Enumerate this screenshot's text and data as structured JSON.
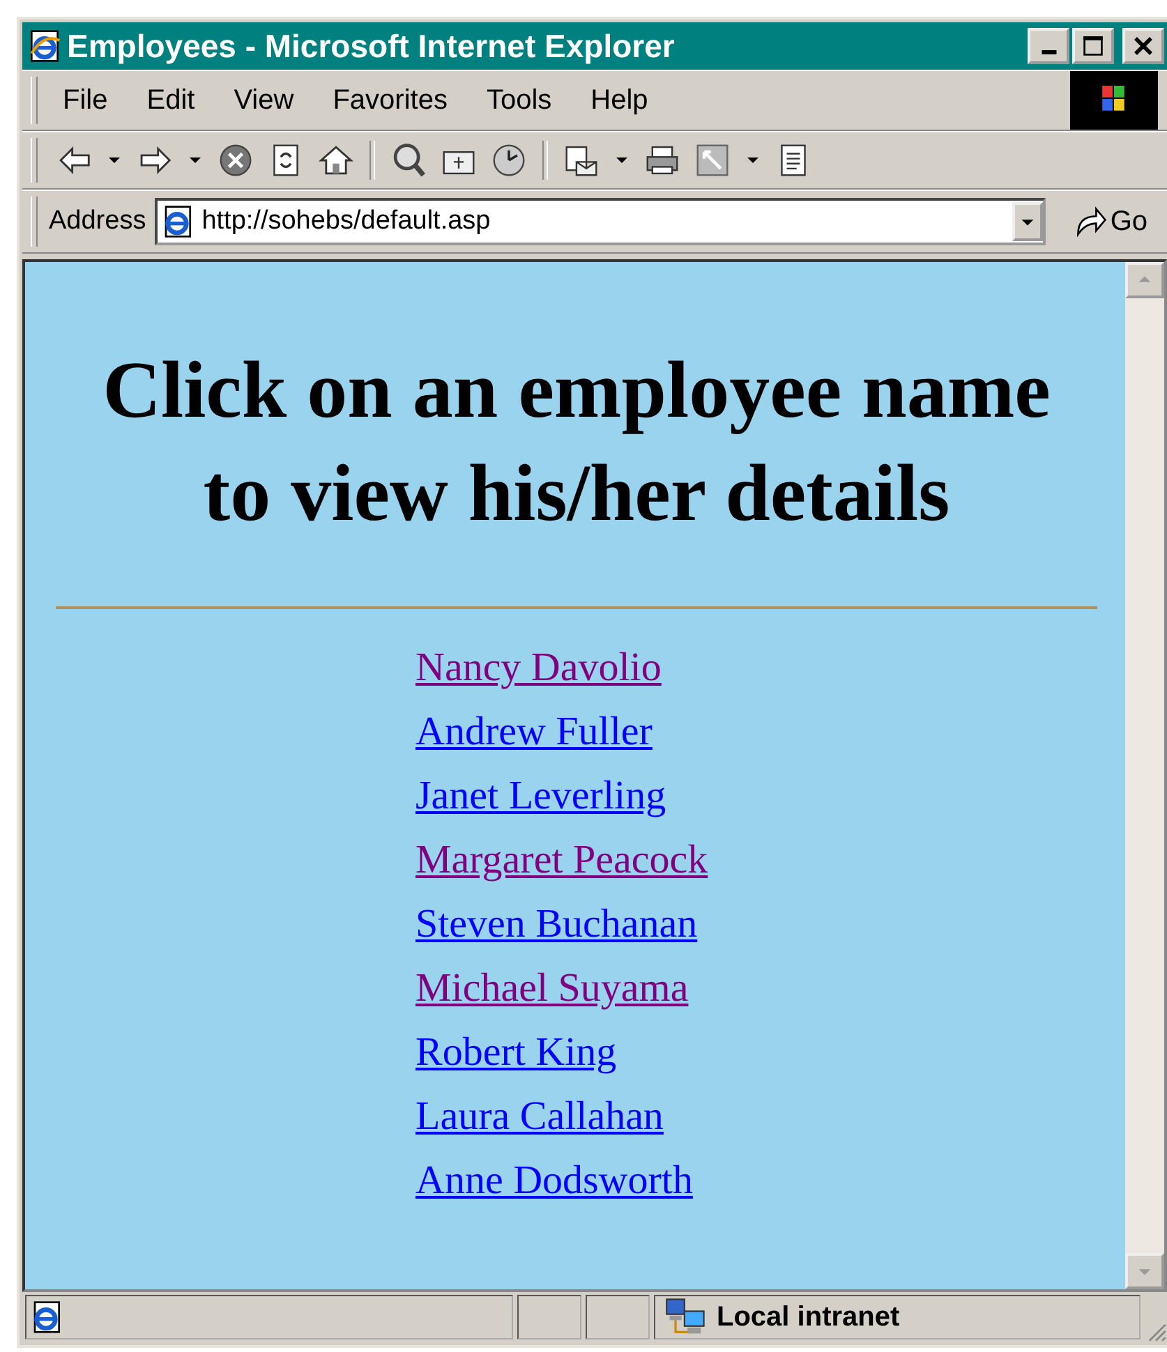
{
  "window": {
    "title": "Employees - Microsoft Internet Explorer"
  },
  "menu": [
    "File",
    "Edit",
    "View",
    "Favorites",
    "Tools",
    "Help"
  ],
  "address_bar": {
    "label": "Address",
    "value": "http://sohebs/default.asp",
    "go": "Go"
  },
  "page": {
    "heading": "Click on an employee name to view his/her details",
    "links": [
      {
        "text": "Nancy Davolio",
        "visited": true
      },
      {
        "text": "Andrew Fuller",
        "visited": false
      },
      {
        "text": "Janet Leverling",
        "visited": false
      },
      {
        "text": "Margaret Peacock",
        "visited": true
      },
      {
        "text": "Steven Buchanan",
        "visited": false
      },
      {
        "text": "Michael Suyama",
        "visited": true
      },
      {
        "text": "Robert King",
        "visited": false
      },
      {
        "text": "Laura Callahan",
        "visited": false
      },
      {
        "text": "Anne Dodsworth",
        "visited": false
      }
    ]
  },
  "status_bar": {
    "zone": "Local intranet"
  }
}
